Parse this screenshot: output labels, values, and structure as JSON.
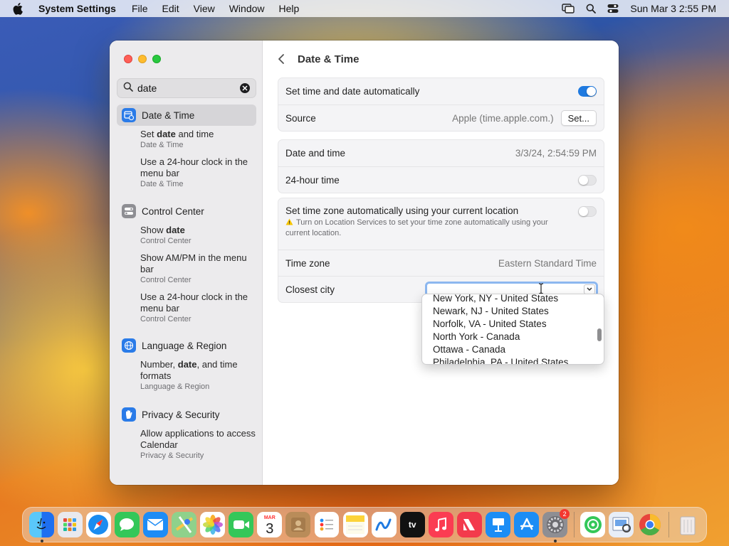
{
  "menubar": {
    "app_name": "System Settings",
    "menus": [
      "File",
      "Edit",
      "View",
      "Window",
      "Help"
    ],
    "clock": "Sun Mar 3  2:55 PM"
  },
  "sidebar": {
    "search_value": "date",
    "sections": [
      {
        "label": "Date & Time",
        "icon": "calendar-clock-icon",
        "color": "#2a7be8",
        "items": [
          {
            "before": "Set ",
            "bold": "date",
            "after": " and time",
            "category": "Date & Time"
          },
          {
            "before": "Use a 24-hour clock in the menu bar",
            "bold": "",
            "after": "",
            "category": "Date & Time"
          }
        ]
      },
      {
        "label": "Control Center",
        "icon": "control-center-icon",
        "color": "#8e8e93",
        "items": [
          {
            "before": "Show ",
            "bold": "date",
            "after": "",
            "category": "Control Center"
          },
          {
            "before": "Show AM/PM in the menu bar",
            "bold": "",
            "after": "",
            "category": "Control Center"
          },
          {
            "before": "Use a 24-hour clock in the menu bar",
            "bold": "",
            "after": "",
            "category": "Control Center"
          }
        ]
      },
      {
        "label": "Language & Region",
        "icon": "globe-icon",
        "color": "#2a7be8",
        "items": [
          {
            "before": "Number, ",
            "bold": "date",
            "after": ", and time formats",
            "category": "Language & Region"
          }
        ]
      },
      {
        "label": "Privacy & Security",
        "icon": "hand-icon",
        "color": "#2a7be8",
        "items": [
          {
            "before": "Allow applications to access Calendar",
            "bold": "",
            "after": "",
            "category": "Privacy & Security"
          }
        ]
      }
    ]
  },
  "main": {
    "title": "Date & Time",
    "auto_time_label": "Set time and date automatically",
    "auto_time_on": true,
    "source_label": "Source",
    "source_value": "Apple (time.apple.com.)",
    "set_button": "Set...",
    "datetime_label": "Date and time",
    "datetime_value": "3/3/24, 2:54:59 PM",
    "hour24_label": "24-hour time",
    "hour24_on": false,
    "auto_tz_label": "Set time zone automatically using your current location",
    "auto_tz_on": false,
    "auto_tz_warning": "Turn on Location Services to set your time zone automatically using your current location.",
    "timezone_label": "Time zone",
    "timezone_value": "Eastern Standard Time",
    "closest_city_label": "Closest city",
    "closest_city_value": ""
  },
  "city_dropdown": {
    "options": [
      "New York, NY - United States",
      "Newark, NJ - United States",
      "Norfolk, VA - United States",
      "North York - Canada",
      "Ottawa - Canada",
      "Philadelphia, PA - United States"
    ]
  },
  "dock": {
    "calendar_month": "MAR",
    "calendar_day": "3",
    "settings_badge": "2",
    "apps": [
      "finder-icon",
      "launchpad-icon",
      "safari-icon",
      "messages-icon",
      "mail-icon",
      "maps-icon",
      "photos-icon",
      "facetime-icon",
      "calendar-icon",
      "contacts-icon",
      "reminders-icon",
      "notes-icon",
      "freeform-icon",
      "tv-icon",
      "music-icon",
      "news-icon",
      "keynote-icon",
      "app-store-icon",
      "system-settings-icon",
      "find-my-icon",
      "preview-icon",
      "chrome-icon",
      "trash-icon"
    ]
  }
}
